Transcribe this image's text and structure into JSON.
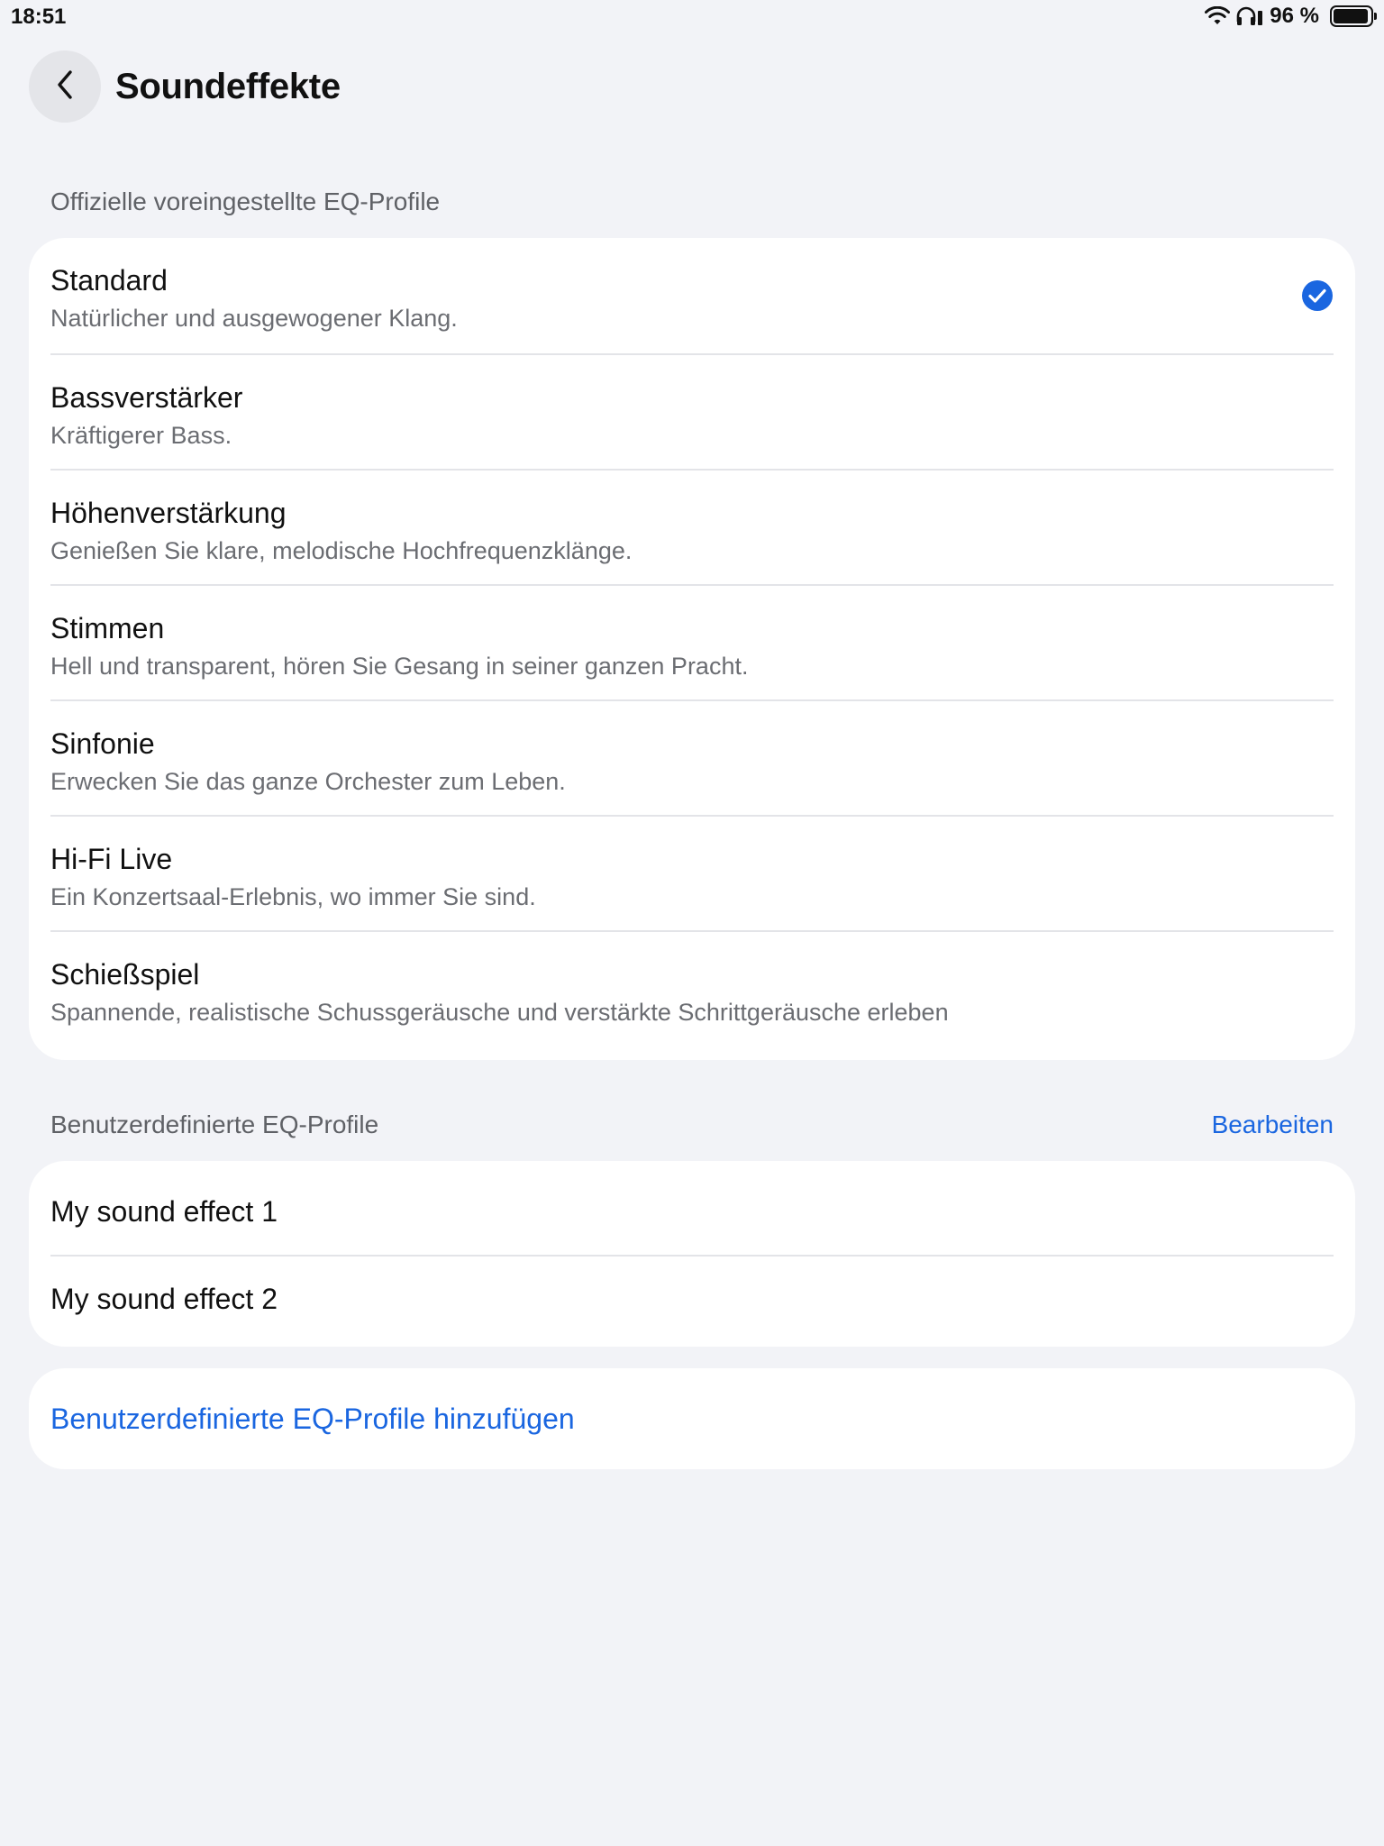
{
  "status_bar": {
    "time": "18:51",
    "battery_text": "96 %",
    "battery_level": 0.96,
    "icons": [
      "wifi-icon",
      "headphones-icon",
      "battery-icon"
    ]
  },
  "header": {
    "title": "Soundeffekte",
    "back_icon": "chevron-left-icon"
  },
  "official_section": {
    "label": "Offizielle voreingestellte EQ-Profile",
    "items": [
      {
        "title": "Standard",
        "description": "Natürlicher und ausgewogener Klang.",
        "selected": true
      },
      {
        "title": "Bassverstärker",
        "description": "Kräftigerer Bass.",
        "selected": false
      },
      {
        "title": "Höhenverstärkung",
        "description": "Genießen Sie klare, melodische Hochfrequenzklänge.",
        "selected": false
      },
      {
        "title": "Stimmen",
        "description": "Hell und transparent, hören Sie Gesang in seiner ganzen Pracht.",
        "selected": false
      },
      {
        "title": "Sinfonie",
        "description": "Erwecken Sie das ganze Orchester zum Leben.",
        "selected": false
      },
      {
        "title": "Hi-Fi Live",
        "description": "Ein Konzertsaal-Erlebnis, wo immer Sie sind.",
        "selected": false
      },
      {
        "title": "Schießspiel",
        "description": "Spannende, realistische Schussgeräusche und verstärkte Schrittgeräusche erleben",
        "selected": false
      }
    ]
  },
  "custom_section": {
    "label": "Benutzerdefinierte EQ-Profile",
    "edit_label": "Bearbeiten",
    "items": [
      {
        "title": "My sound effect 1"
      },
      {
        "title": "My sound effect 2"
      }
    ]
  },
  "add_custom_label": "Benutzerdefinierte EQ-Profile hinzufügen",
  "colors": {
    "background": "#f2f3f7",
    "card": "#ffffff",
    "accent": "#1a66e0",
    "secondary_text": "#6b6d72"
  }
}
